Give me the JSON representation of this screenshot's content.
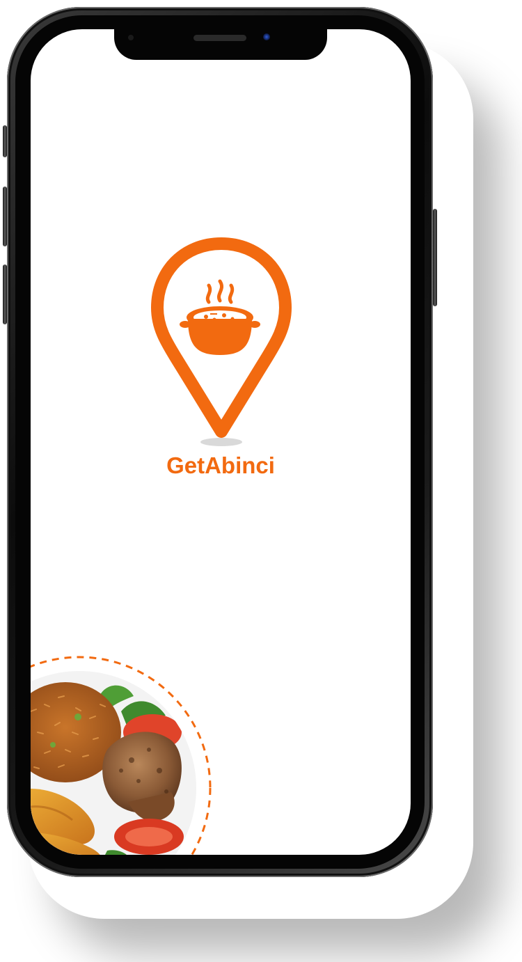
{
  "app": {
    "brand_name": "GetAbinci"
  },
  "icons": {
    "logo": "location-pin-with-food-pot-icon"
  },
  "colors": {
    "brand_orange": "#f26a10",
    "screen_background": "#ffffff",
    "device_frame": "#0c0c0c"
  },
  "images": {
    "food_plate": "plate-of-jollof-rice-chicken-plantain-tomato"
  }
}
